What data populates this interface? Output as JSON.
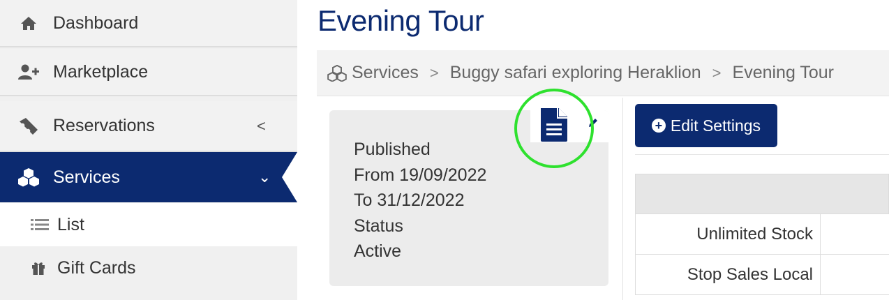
{
  "sidebar": {
    "items": [
      {
        "label": "Dashboard",
        "icon": "home-icon"
      },
      {
        "label": "Marketplace",
        "icon": "user-plus-icon"
      },
      {
        "label": "Reservations",
        "icon": "ticket-icon",
        "chevron": "<"
      },
      {
        "label": "Services",
        "icon": "cubes-icon",
        "chevron": "⌄",
        "active": true
      }
    ],
    "sub_items": [
      {
        "label": "List",
        "icon": "list-icon"
      },
      {
        "label": "Gift Cards",
        "icon": "gift-icon"
      }
    ]
  },
  "page": {
    "title": "Evening Tour"
  },
  "breadcrumb": {
    "items": [
      "Services",
      "Buggy safari exploring Heraklion",
      "Evening Tour"
    ],
    "separator": ">"
  },
  "info_card": {
    "lines": [
      "Published",
      "From 19/09/2022",
      "To 31/12/2022",
      "Status",
      "Active"
    ]
  },
  "toolbar": {
    "edit_label": "Edit Settings"
  },
  "table": {
    "rows": [
      "Unlimited Stock",
      "Stop Sales Local"
    ]
  },
  "colors": {
    "brand": "#0c2a70",
    "highlight": "#2ee12e",
    "sidebar_bg": "#f0f0f0"
  }
}
